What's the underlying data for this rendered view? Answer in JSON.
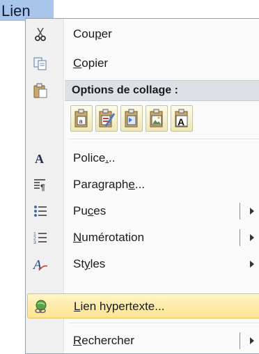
{
  "selected_word": "Lien",
  "menu": {
    "items": [
      {
        "name": "cut",
        "label": "Couper",
        "icon": "scissors-icon"
      },
      {
        "name": "copy",
        "label": "Copier",
        "icon": "copy-icon"
      },
      {
        "name": "paste_header",
        "label": "Options de collage :",
        "icon": "clipboard-icon"
      }
    ],
    "paste_options": [
      "keep-source-formatting-icon",
      "merge-formatting-icon",
      "use-destination-styles-icon",
      "picture-icon",
      "keep-text-only-icon"
    ],
    "items2": [
      {
        "label": "Police...",
        "icon": "font-icon"
      },
      {
        "label": "Paragraphe...",
        "icon": "paragraph-icon"
      },
      {
        "label": "Puces",
        "icon": "bullets-icon"
      },
      {
        "label": "Numérotation",
        "icon": "numbering-icon"
      },
      {
        "label": "Styles",
        "icon": "styles-icon"
      },
      {
        "label": "Lien hypertexte...",
        "icon": "hyperlink-icon"
      },
      {
        "label": "Rechercher",
        "icon": "search-icon"
      }
    ],
    "highlight_color": "#fde48f"
  }
}
